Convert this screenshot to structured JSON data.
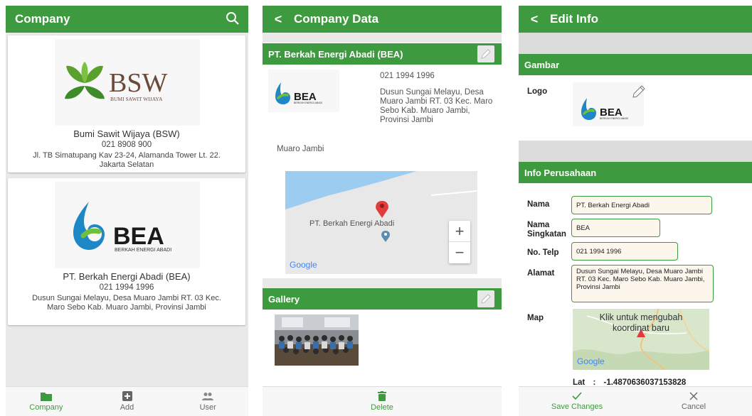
{
  "screen1": {
    "title": "Company",
    "companies": [
      {
        "name": "Bumi Sawit Wijaya (BSW)",
        "phone": "021 8908 900",
        "address": "Jl. TB Simatupang Kav 23-24, Alamanda Tower Lt. 22. Jakarta Selatan",
        "logo_main": "BSW",
        "logo_sub": "BUMI SAWIT WIJAYA"
      },
      {
        "name": "PT. Berkah Energi Abadi (BEA)",
        "phone": "021 1994 1996",
        "address": "Dusun Sungai Melayu, Desa Muaro Jambi RT. 03 Kec. Maro Sebo Kab. Muaro Jambi, Provinsi Jambi",
        "logo_main": "BEA",
        "logo_sub": "BERKAH ENERGI ABADI"
      }
    ],
    "nav": [
      {
        "label": "Company",
        "icon": "folder-icon"
      },
      {
        "label": "Add",
        "icon": "add-icon"
      },
      {
        "label": "User",
        "icon": "users-icon"
      }
    ]
  },
  "screen2": {
    "title": "Company Data",
    "company_title": "PT. Berkah Energi Abadi (BEA)",
    "phone": "021 1994 1996",
    "address": "Dusun Sungai Melayu, Desa Muaro Jambi RT. 03 Kec. Maro Sebo Kab. Muaro Jambi, Provinsi Jambi",
    "city": "Muaro Jambi",
    "map_label": "PT. Berkah Energi Abadi",
    "map_brand": "Google",
    "logo_main": "BEA",
    "logo_sub": "BERKAH ENERGI ABADI",
    "gallery_title": "Gallery",
    "delete_label": "Delete"
  },
  "screen3": {
    "title": "Edit Info",
    "section_image": "Gambar",
    "logo_label": "Logo",
    "logo_main": "BEA",
    "logo_sub": "BERKAH ENERGI ABADI",
    "section_info": "Info Perusahaan",
    "fields": {
      "nama_label": "Nama",
      "nama_value": "PT. Berkah Energi Abadi",
      "singkatan_label": "Nama Singkatan",
      "singkatan_value": "BEA",
      "telp_label": "No. Telp",
      "telp_value": "021 1994 1996",
      "alamat_label": "Alamat",
      "alamat_value": "Dusun Sungai Melayu, Desa Muaro Jambi RT. 03 Kec. Maro Sebo Kab. Muaro Jambi, Provinsi Jambi",
      "map_label": "Map",
      "map_hint": "Klik untuk mengubah koordinat baru",
      "map_brand": "Google",
      "lat_label": "Lat",
      "lat_sep": ":",
      "lat_value": "-1.4870636037153828"
    },
    "save_label": "Save Changes",
    "cancel_label": "Cancel"
  },
  "colors": {
    "primary": "#3d9a3f",
    "field_bg": "#fdf6ec",
    "danger": "#555555"
  }
}
